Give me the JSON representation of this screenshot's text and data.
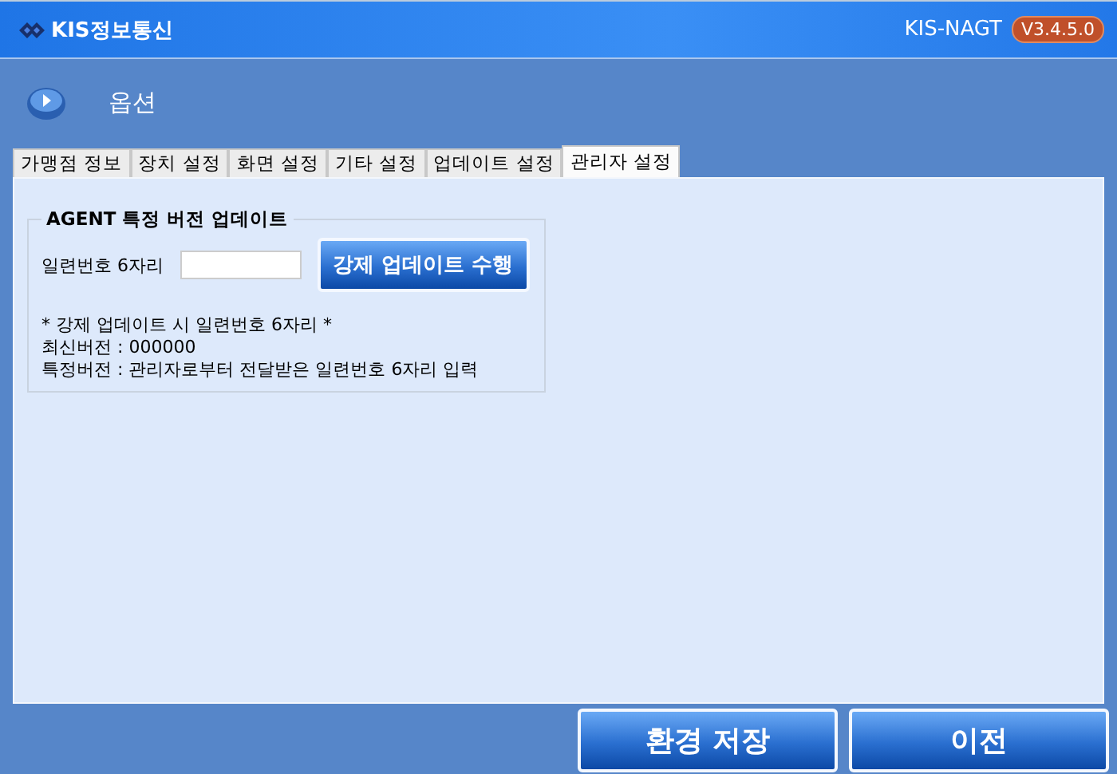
{
  "title_bar": {
    "brand": "KIS정보통신",
    "product": "KIS-NAGT",
    "version": "V3.4.5.0"
  },
  "header": {
    "title": "옵션"
  },
  "tabs": [
    {
      "label": "가맹점 정보",
      "selected": false
    },
    {
      "label": "장치 설정",
      "selected": false
    },
    {
      "label": "화면 설정",
      "selected": false
    },
    {
      "label": "기타 설정",
      "selected": false
    },
    {
      "label": "업데이트 설정",
      "selected": false
    },
    {
      "label": "관리자 설정",
      "selected": true
    }
  ],
  "group": {
    "legend": "AGENT 특정 버전 업데이트",
    "field_label": "일련번호 6자리",
    "button": "강제 업데이트 수행",
    "notes": [
      "* 강제 업데이트 시 일련번호 6자리 *",
      "최신버전 : 000000",
      "특정버전 : 관리자로부터 전달받은 일련번호 6자리 입력"
    ]
  },
  "footer_buttons": [
    "환경 저장",
    "이전"
  ]
}
